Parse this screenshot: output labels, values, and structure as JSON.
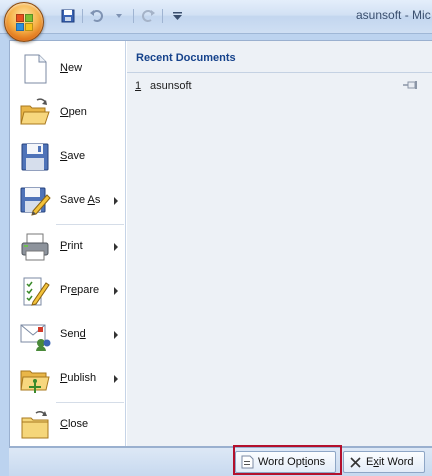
{
  "window": {
    "title": "asunsoft - Mic"
  },
  "quick_access": {
    "items": [
      {
        "name": "save-icon"
      },
      {
        "name": "undo-icon"
      },
      {
        "name": "redo-icon"
      },
      {
        "name": "customize-qat-icon"
      }
    ]
  },
  "office_menu": {
    "commands": [
      {
        "id": "new",
        "label_accel": "N",
        "label_rest": "ew",
        "icon": "new-document-icon",
        "submenu": false
      },
      {
        "id": "open",
        "label_accel": "O",
        "label_rest": "pen",
        "icon": "open-folder-icon",
        "submenu": false
      },
      {
        "id": "save",
        "label_accel": "S",
        "label_rest": "ave",
        "icon": "floppy-disk-icon",
        "submenu": false
      },
      {
        "id": "save-as",
        "label_pre": "Save ",
        "label_accel": "A",
        "label_rest": "s",
        "icon": "save-as-icon",
        "submenu": true
      },
      {
        "id": "print",
        "label_accel": "P",
        "label_rest": "rint",
        "icon": "printer-icon",
        "submenu": true
      },
      {
        "id": "prepare",
        "label_pre": "Pr",
        "label_accel": "e",
        "label_rest": "pare",
        "icon": "prepare-checklist-icon",
        "submenu": true
      },
      {
        "id": "send",
        "label_pre": "Sen",
        "label_accel": "d",
        "label_rest": "",
        "icon": "send-mail-icon",
        "submenu": true
      },
      {
        "id": "publish",
        "label_accel": "P",
        "label_pre": "",
        "label_rest": "ublish",
        "icon": "publish-folder-icon",
        "submenu": true
      },
      {
        "id": "close",
        "label_accel": "C",
        "label_rest": "lose",
        "icon": "close-folder-icon",
        "submenu": false
      }
    ],
    "recent": {
      "heading": "Recent Documents",
      "items": [
        {
          "number": "1",
          "name": "asunsoft",
          "pinned": false
        }
      ]
    }
  },
  "footer": {
    "word_options": {
      "accel": "i",
      "pre": "Word Opt",
      "post": "ons"
    },
    "exit_word": {
      "accel": "x",
      "pre": "E",
      "post": "it Word"
    }
  },
  "colors": {
    "highlight_border": "#b3102c",
    "recent_heading": "#15428b"
  }
}
